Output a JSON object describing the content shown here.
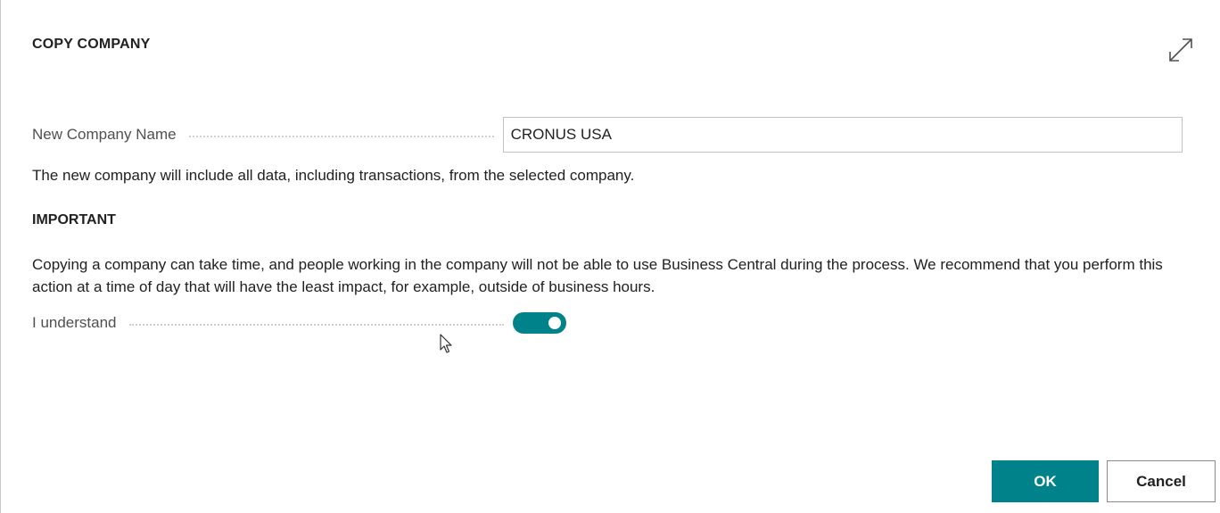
{
  "dialog": {
    "title": "COPY COMPANY",
    "expand_icon": "expand-diagonal-icon"
  },
  "new_company": {
    "label": "New Company Name",
    "value": "CRONUS USA"
  },
  "info_text": "The new company will include all data, including transactions, from the selected company.",
  "important_heading": "IMPORTANT",
  "warning_text": "Copying a company can take time, and people working in the company will not be able to use Business Central during the process. We recommend that you perform this action at a time of day that will have the least impact, for example, outside of business hours.",
  "understand": {
    "label": "I understand",
    "checked": true
  },
  "buttons": {
    "ok": "OK",
    "cancel": "Cancel"
  },
  "colors": {
    "accent": "#00828a"
  }
}
